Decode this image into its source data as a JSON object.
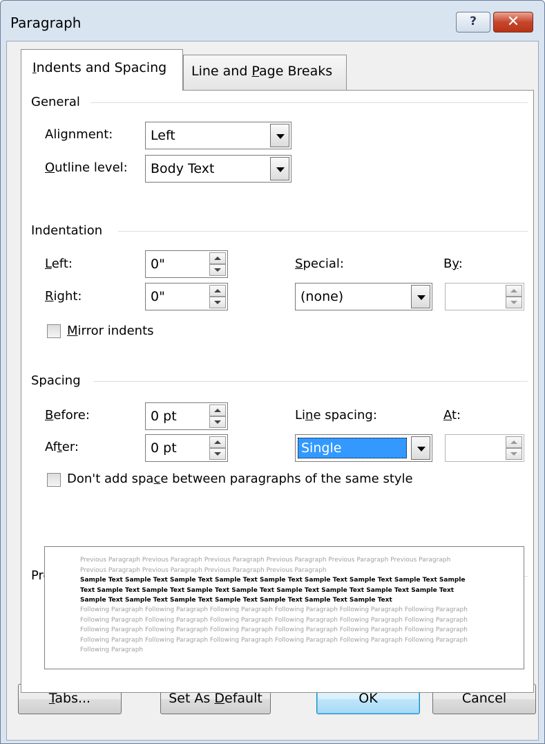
{
  "window": {
    "title": "Paragraph"
  },
  "tabs": [
    {
      "label": "Indents and Spacing",
      "accel": "I",
      "rest": "ndents and Spacing",
      "active": true
    },
    {
      "label": "Line and Page Breaks",
      "pre": "Line and ",
      "accel": "P",
      "rest": "age Breaks",
      "active": false
    }
  ],
  "general": {
    "section_label": "General",
    "alignment": {
      "pre": "Ali",
      "accel": "g",
      "rest": "nment:",
      "value": "Left"
    },
    "outline_level": {
      "pre": "",
      "accel": "O",
      "rest": "utline level:",
      "value": "Body Text"
    }
  },
  "indentation": {
    "section_label": "Indentation",
    "left": {
      "accel": "L",
      "rest": "eft:",
      "value": "0\""
    },
    "right": {
      "accel": "R",
      "rest": "ight:",
      "value": "0\""
    },
    "special": {
      "accel": "S",
      "rest": "pecial:",
      "value": "(none)"
    },
    "by": {
      "pre": "B",
      "accel": "y",
      "rest": ":",
      "value": ""
    },
    "mirror": {
      "accel": "M",
      "rest": "irror indents",
      "checked": false
    }
  },
  "spacing": {
    "section_label": "Spacing",
    "before": {
      "accel": "B",
      "rest": "efore:",
      "value": "0 pt"
    },
    "after": {
      "pre": "Af",
      "accel": "t",
      "rest": "er:",
      "value": "0 pt"
    },
    "line_spacing": {
      "pre": "Li",
      "accel": "n",
      "rest": "e spacing:",
      "value": "Single"
    },
    "at": {
      "accel": "A",
      "rest": "t:",
      "value": ""
    },
    "dont_add": {
      "pre": "Don't add spa",
      "accel": "c",
      "rest": "e between paragraphs of the same style",
      "checked": false
    }
  },
  "preview": {
    "section_label": "Preview",
    "previous": "Previous Paragraph Previous Paragraph Previous Paragraph Previous Paragraph Previous Paragraph Previous Paragraph Previous Paragraph Previous Paragraph Previous Paragraph Previous Paragraph",
    "sample": "Sample Text Sample Text Sample Text Sample Text Sample Text Sample Text Sample Text Sample Text Sample Text Sample Text Sample Text Sample Text Sample Text Sample Text Sample Text Sample Text Sample Text Sample Text Sample Text Sample Text Sample Text Sample Text Sample Text Sample Text",
    "following": "Following Paragraph Following Paragraph Following Paragraph Following Paragraph Following Paragraph Following Paragraph Following Paragraph Following Paragraph Following Paragraph Following Paragraph Following Paragraph Following Paragraph Following Paragraph Following Paragraph Following Paragraph Following Paragraph Following Paragraph Following Paragraph Following Paragraph Following Paragraph Following Paragraph Following Paragraph Following Paragraph Following Paragraph Following Paragraph"
  },
  "buttons": {
    "tabs": {
      "accel": "T",
      "rest": "abs..."
    },
    "set_default": {
      "pre": "Set As ",
      "accel": "D",
      "rest": "efault"
    },
    "ok": "OK",
    "cancel": "Cancel"
  }
}
